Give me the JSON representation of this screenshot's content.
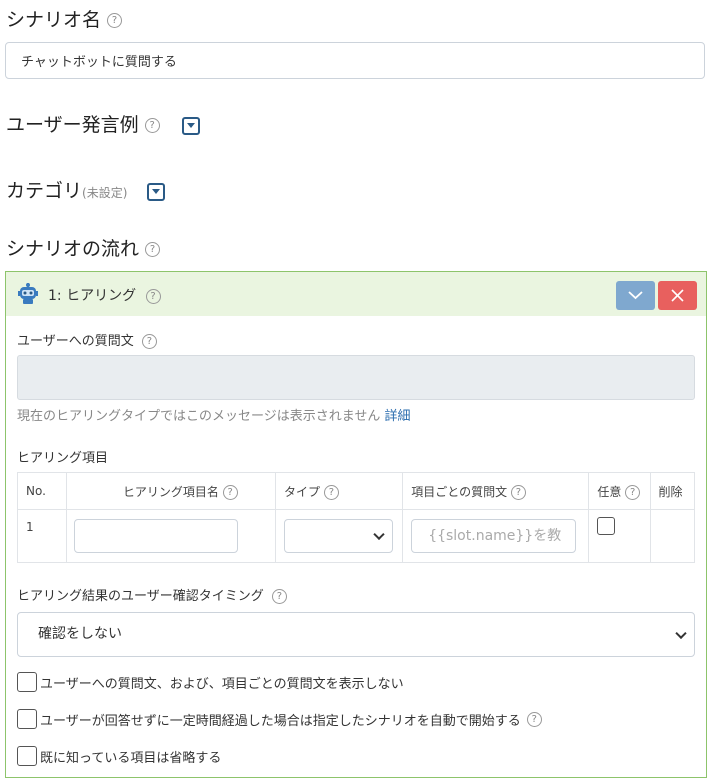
{
  "scenario_name": {
    "label": "シナリオ名",
    "value": "チャットボットに質問する"
  },
  "user_examples": {
    "label": "ユーザー発言例"
  },
  "category": {
    "label": "カテゴリ",
    "note": "(未設定)"
  },
  "flow": {
    "label": "シナリオの流れ"
  },
  "step": {
    "title": "1: ヒアリング"
  },
  "question": {
    "label": "ユーザーへの質問文",
    "notice": "現在のヒアリングタイプではこのメッセージは表示されません",
    "notice_link": "詳細"
  },
  "hearing_items": {
    "label": "ヒアリング項目",
    "headers": [
      "No.",
      "ヒアリング項目名",
      "タイプ",
      "項目ごとの質問文",
      "任意",
      "削除"
    ],
    "row": {
      "no": "1",
      "question_placeholder": "{{slot.name}}を教"
    }
  },
  "confirm": {
    "label": "ヒアリング結果のユーザー確認タイミング",
    "selected": "確認をしない"
  },
  "options": [
    {
      "label": "ユーザーへの質問文、および、項目ごとの質問文を表示しない"
    },
    {
      "label": "ユーザーが回答せずに一定時間経過した場合は指定したシナリオを自動で開始する"
    },
    {
      "label": "既に知っている項目は省略する"
    }
  ],
  "help_glyph": "?",
  "colors": {
    "panel_border": "#8dc46b",
    "panel_header": "#eaf5e0",
    "collapse_button": "#7fa8cf",
    "delete_button": "#e8605e",
    "link": "#2a6cae"
  }
}
